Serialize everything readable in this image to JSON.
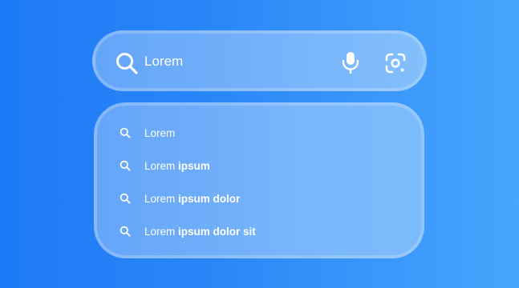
{
  "search": {
    "query": "Lorem",
    "search_icon": "search-icon",
    "mic_icon": "microphone-icon",
    "lens_icon": "image-search-icon"
  },
  "suggestions": [
    {
      "normal": "Lorem",
      "bold": ""
    },
    {
      "normal": "Lorem ",
      "bold": "ipsum"
    },
    {
      "normal": "Lorem ",
      "bold": "ipsum dolor"
    },
    {
      "normal": "Lorem ",
      "bold": "ipsum dolor sit"
    }
  ],
  "colors": {
    "background_start": "#1d7af6",
    "background_end": "#46a5fd",
    "text": "#ffffff"
  }
}
